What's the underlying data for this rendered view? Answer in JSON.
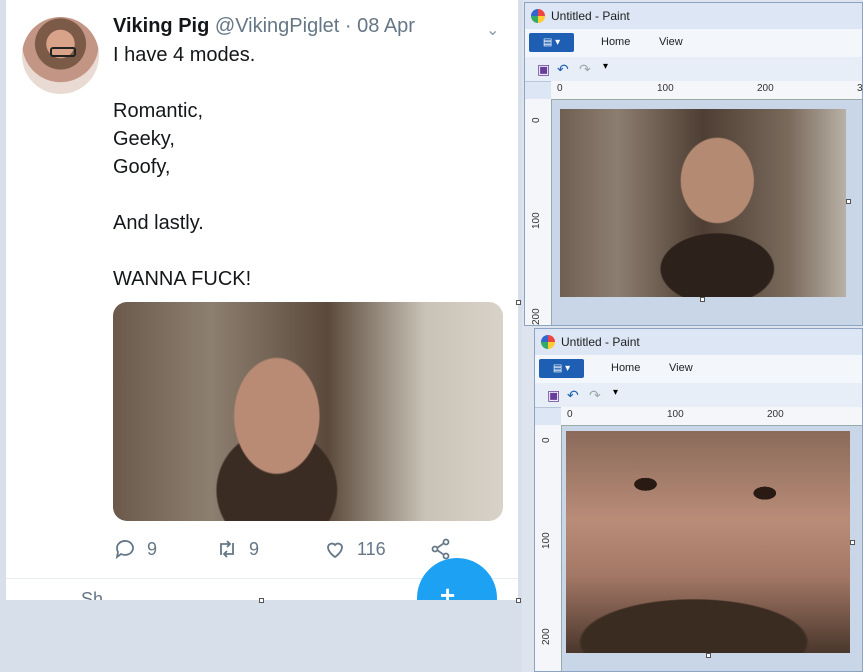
{
  "tweet": {
    "display_name": "Viking Pig",
    "handle": "@VikingPiglet",
    "separator": "·",
    "date": "08 Apr",
    "lines": [
      "I have 4 modes.",
      "Romantic,",
      "Geeky,",
      "Goofy,",
      "And lastly.",
      "WANNA FUCK!"
    ],
    "reply_count": "9",
    "retweet_count": "9",
    "like_count": "116",
    "cutoff_text": "Sh..."
  },
  "paint_top": {
    "title": "Untitled - Paint",
    "tabs": [
      "Home",
      "View"
    ],
    "ruler_h": [
      "0",
      "100",
      "200",
      "3"
    ],
    "ruler_v": [
      "0",
      "100",
      "200"
    ]
  },
  "paint_bottom": {
    "title": "Untitled - Paint",
    "tabs": [
      "Home",
      "View"
    ],
    "ruler_h": [
      "0",
      "100",
      "200"
    ],
    "ruler_v": [
      "0",
      "100",
      "200"
    ]
  },
  "colors": {
    "twitter_blue": "#1da1f2",
    "paint_file_button": "#1e5fb3"
  },
  "icons": {
    "reply": "speech-bubble",
    "retweet": "retweet-arrows",
    "like": "heart",
    "share": "share-nodes",
    "compose": "compose-feather"
  }
}
